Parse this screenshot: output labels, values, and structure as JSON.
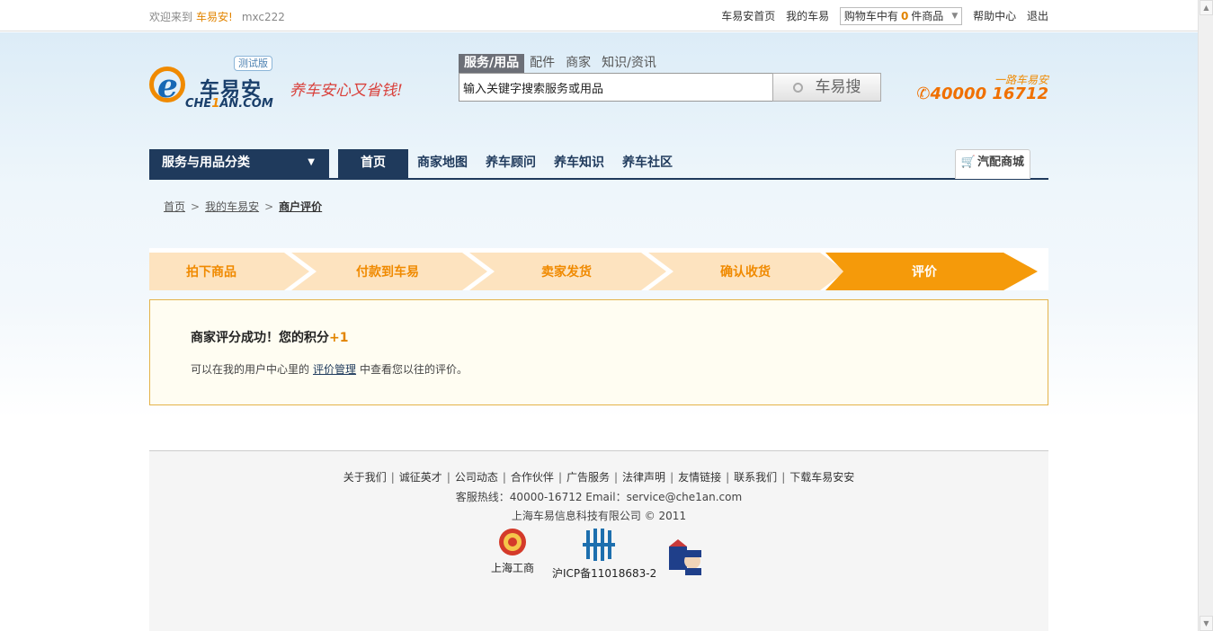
{
  "topbar": {
    "welcome_text": "欢迎来到",
    "site_name": "车易安!",
    "username": "mxc222",
    "links": {
      "home": "车易安首页",
      "my": "我的车易",
      "help": "帮助中心",
      "logout": "退出"
    },
    "cart": {
      "prefix": "购物车中有",
      "count": "0",
      "suffix": "件商品"
    }
  },
  "logo": {
    "name_cn": "车易安",
    "name_en_pre": "CHE",
    "name_en_num": "1",
    "name_en_post": "AN.COM",
    "beta_badge": "测试版",
    "slogan": "养车安心又省钱!"
  },
  "search": {
    "tabs": [
      "服务/用品",
      "配件",
      "商家",
      "知识/资讯"
    ],
    "active_tab": "服务/用品",
    "placeholder": "输入关键字搜索服务或用品",
    "button_label": "车易搜"
  },
  "hotline": {
    "tagline": "一路车易安",
    "number": "40000 16712"
  },
  "nav": {
    "category_label": "服务与用品分类",
    "items": [
      "首页",
      "商家地图",
      "养车顾问",
      "养车知识",
      "养车社区"
    ],
    "mall_label": "汽配商城"
  },
  "breadcrumb": {
    "items": [
      "首页",
      "我的车易安"
    ],
    "current": "商户评价",
    "separator": ">"
  },
  "steps": {
    "items": [
      "拍下商品",
      "付款到车易",
      "卖家发货",
      "确认收货",
      "评价"
    ],
    "active_index": 4,
    "colors": {
      "inactive": "#fde3bf",
      "active": "#f59a0a",
      "text_inactive": "#f08a00"
    }
  },
  "message": {
    "title": "商家评分成功！您的积分",
    "points": "+1",
    "desc_pre": "可以在我的用户中心里的",
    "desc_link": "评价管理",
    "desc_post": "中查看您以往的评价。"
  },
  "footer": {
    "links": [
      "关于我们",
      "诚征英才",
      "公司动态",
      "合作伙伴",
      "广告服务",
      "法律声明",
      "友情链接",
      "联系我们",
      "下载车易安安"
    ],
    "hotline_line": "客服热线：40000-16712 Email：service@che1an.com",
    "copyright_line": "上海车易信息科技有限公司 © 2011",
    "badges": {
      "commerce": "上海工商",
      "icp": "沪ICP备11018683-2"
    }
  }
}
